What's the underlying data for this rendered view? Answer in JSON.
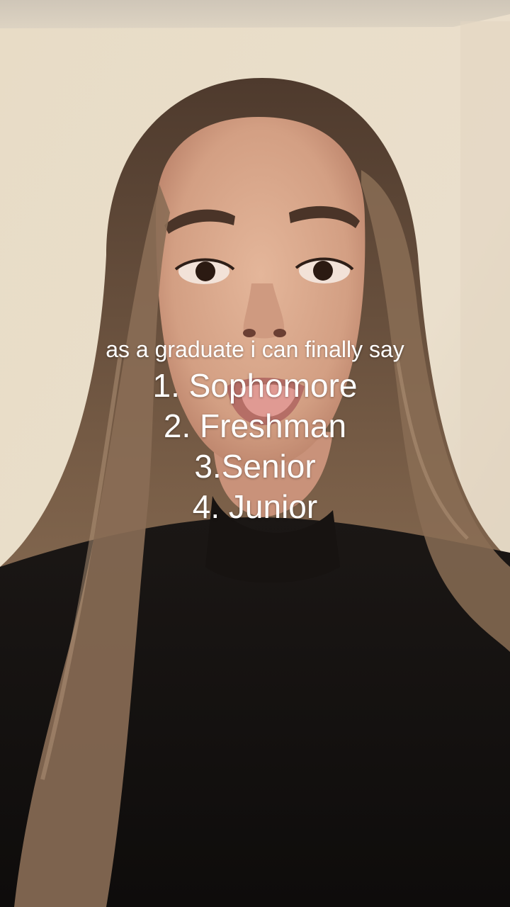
{
  "overlay": {
    "intro": "as a graduate i can finally say",
    "rankings": [
      "1. Sophomore",
      "2. Freshman",
      "3.Senior",
      "4. Junior"
    ]
  },
  "colors": {
    "wall": "#e6dccb",
    "hair": "#6b5240",
    "skin": "#d7a98c",
    "sweater": "#141111",
    "text": "#ffffff"
  }
}
